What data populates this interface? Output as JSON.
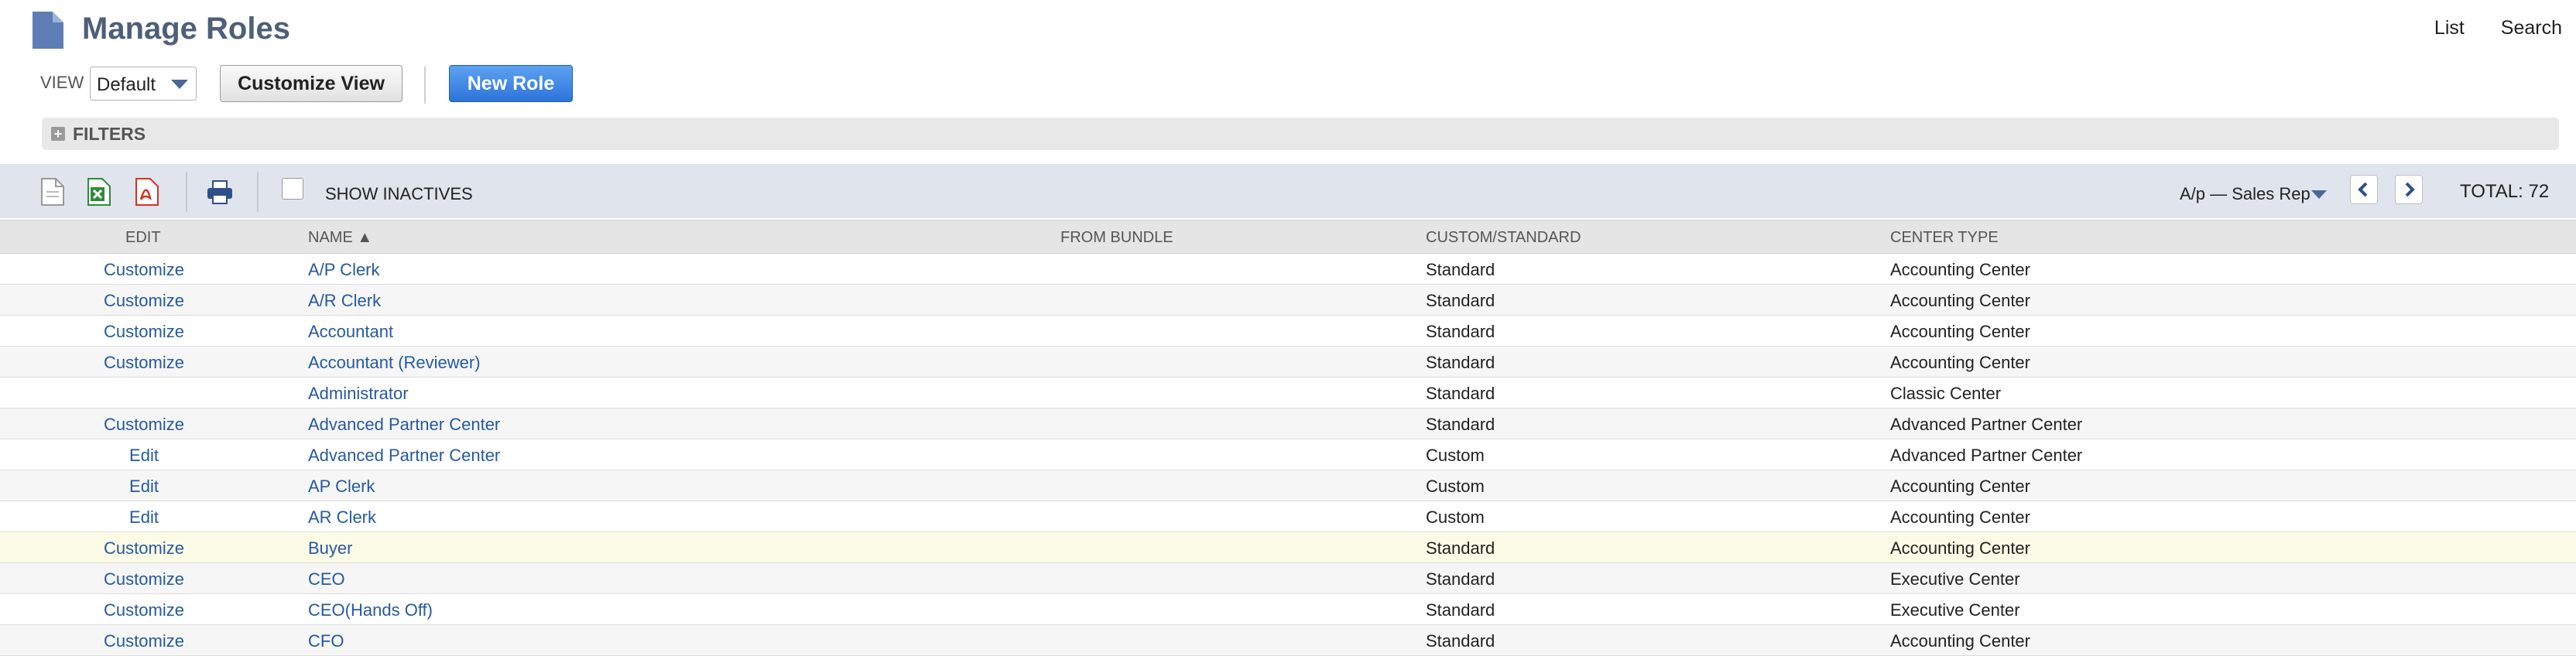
{
  "header": {
    "title": "Manage Roles",
    "links": [
      "List",
      "Search"
    ]
  },
  "view": {
    "label": "VIEW",
    "selected": "Default"
  },
  "buttons": {
    "customize_view": "Customize View",
    "new_role": "New Role"
  },
  "filters": {
    "label": "FILTERS"
  },
  "list_toolbar": {
    "show_inactives": "SHOW INACTIVES",
    "filter_value": "A/p — Sales Rep",
    "total": "TOTAL: 72"
  },
  "columns": {
    "edit": "EDIT",
    "name": "NAME ▲",
    "from_bundle": "FROM BUNDLE",
    "custom_standard": "CUSTOM/STANDARD",
    "center_type": "CENTER TYPE"
  },
  "rows": [
    {
      "edit": "Customize",
      "name": "A/P Clerk",
      "from_bundle": "",
      "custom_standard": "Standard",
      "center_type": "Accounting Center"
    },
    {
      "edit": "Customize",
      "name": "A/R Clerk",
      "from_bundle": "",
      "custom_standard": "Standard",
      "center_type": "Accounting Center"
    },
    {
      "edit": "Customize",
      "name": "Accountant",
      "from_bundle": "",
      "custom_standard": "Standard",
      "center_type": "Accounting Center"
    },
    {
      "edit": "Customize",
      "name": "Accountant (Reviewer)",
      "from_bundle": "",
      "custom_standard": "Standard",
      "center_type": "Accounting Center"
    },
    {
      "edit": "",
      "name": "Administrator",
      "from_bundle": "",
      "custom_standard": "Standard",
      "center_type": "Classic Center"
    },
    {
      "edit": "Customize",
      "name": "Advanced Partner Center",
      "from_bundle": "",
      "custom_standard": "Standard",
      "center_type": "Advanced Partner Center"
    },
    {
      "edit": "Edit",
      "name": "Advanced Partner Center",
      "from_bundle": "",
      "custom_standard": "Custom",
      "center_type": "Advanced Partner Center"
    },
    {
      "edit": "Edit",
      "name": "AP Clerk",
      "from_bundle": "",
      "custom_standard": "Custom",
      "center_type": "Accounting Center"
    },
    {
      "edit": "Edit",
      "name": "AR Clerk",
      "from_bundle": "",
      "custom_standard": "Custom",
      "center_type": "Accounting Center"
    },
    {
      "edit": "Customize",
      "name": "Buyer",
      "from_bundle": "",
      "custom_standard": "Standard",
      "center_type": "Accounting Center"
    },
    {
      "edit": "Customize",
      "name": "CEO",
      "from_bundle": "",
      "custom_standard": "Standard",
      "center_type": "Executive Center"
    },
    {
      "edit": "Customize",
      "name": "CEO(Hands Off)",
      "from_bundle": "",
      "custom_standard": "Standard",
      "center_type": "Executive Center"
    },
    {
      "edit": "Customize",
      "name": "CFO",
      "from_bundle": "",
      "custom_standard": "Standard",
      "center_type": "Accounting Center"
    }
  ],
  "colors": {
    "title": "#4d5f79",
    "link": "#255aa0",
    "primary_button": "#2d74d9",
    "toolbar_bg": "#dfe4ed",
    "highlight_row": "#fcfce6"
  },
  "icons": [
    "document-icon",
    "new-record-icon",
    "excel-export-icon",
    "pdf-export-icon",
    "print-icon",
    "chevron-left-icon",
    "chevron-right-icon"
  ]
}
